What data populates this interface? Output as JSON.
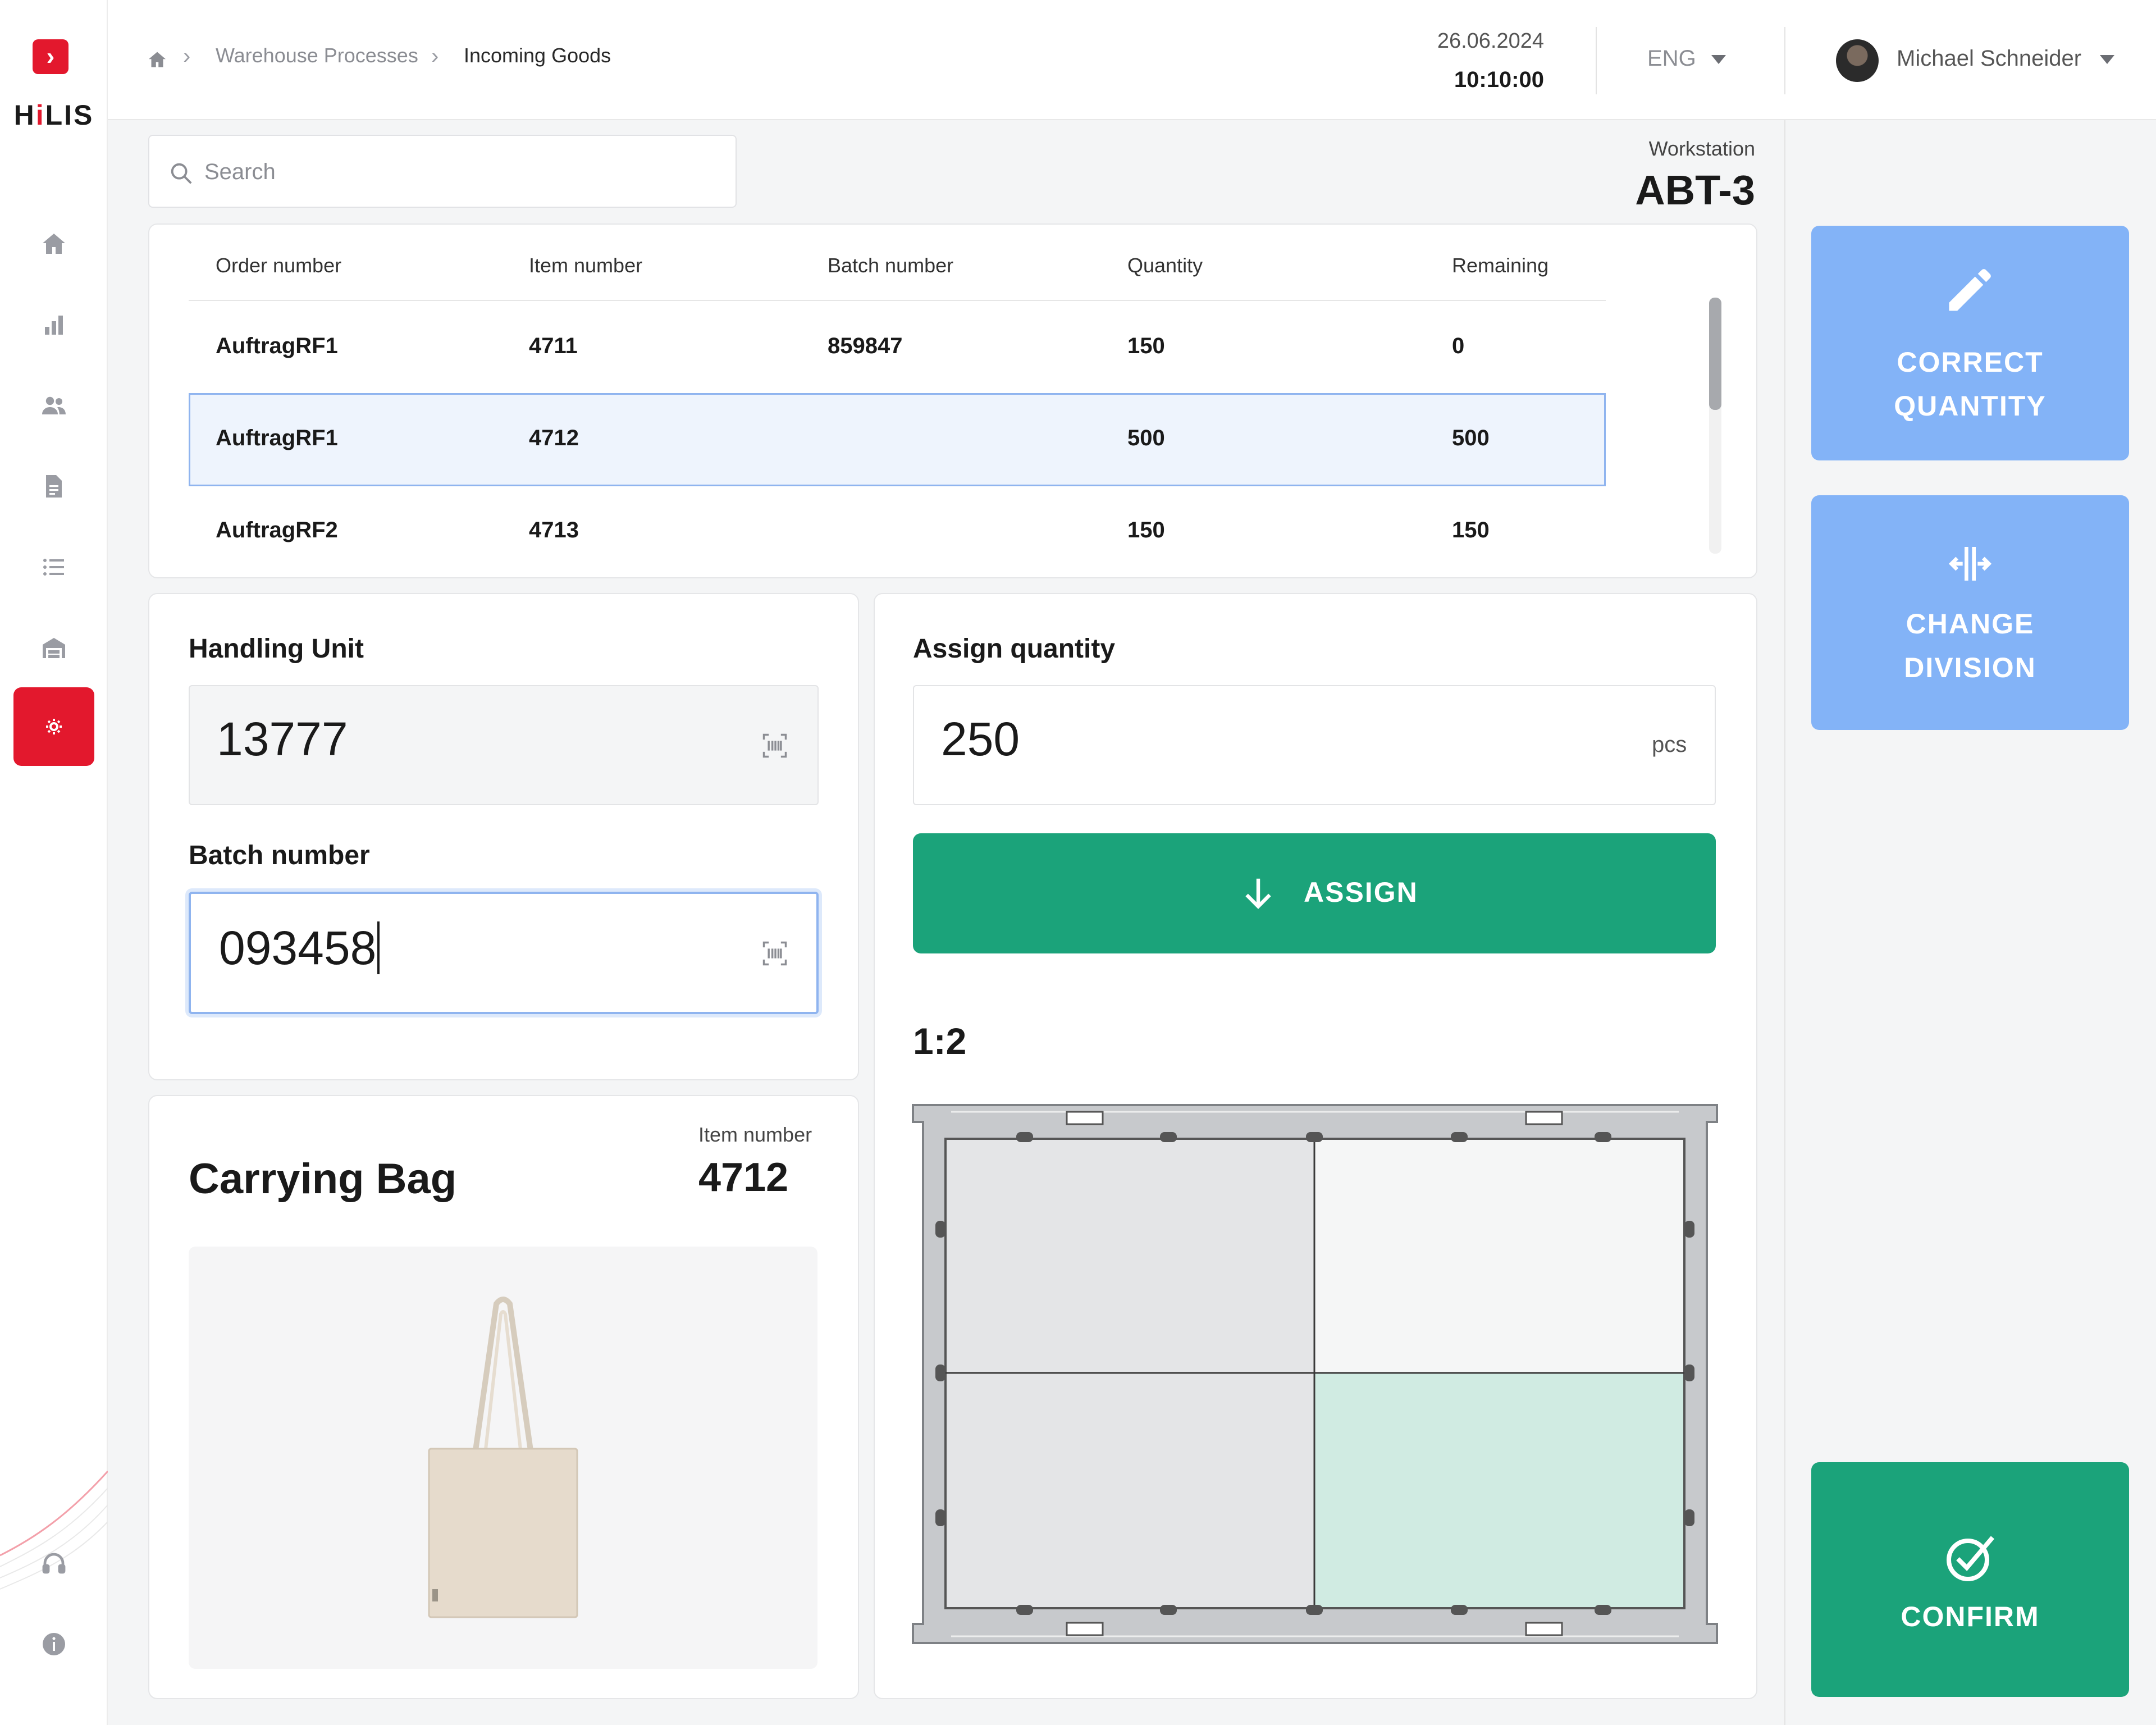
{
  "sidebar": {
    "logo_glyph": "›",
    "brand_h": "H",
    "brand_i": "i",
    "brand_rest": "LIS",
    "items": [
      {
        "icon": "home-icon"
      },
      {
        "icon": "bar-chart-icon"
      },
      {
        "icon": "users-icon"
      },
      {
        "icon": "document-icon"
      },
      {
        "icon": "list-icon"
      },
      {
        "icon": "warehouse-icon"
      },
      {
        "icon": "process-gear-icon",
        "active": true
      }
    ],
    "bottom_items": [
      {
        "icon": "headset-icon"
      },
      {
        "icon": "info-icon"
      }
    ]
  },
  "header": {
    "breadcrumb": [
      "Warehouse Processes",
      "Incoming Goods"
    ],
    "date": "26.06.2024",
    "time": "10:10:00",
    "language": "ENG",
    "user_name": "Michael Schneider"
  },
  "search": {
    "placeholder": "Search"
  },
  "workstation": {
    "label": "Workstation",
    "value": "ABT-3"
  },
  "orders_table": {
    "columns": [
      "Order number",
      "Item number",
      "Batch number",
      "Quantity",
      "Remaining"
    ],
    "rows": [
      [
        "AuftragRF1",
        "4711",
        "859847",
        "150",
        "0"
      ],
      [
        "AuftragRF1",
        "4712",
        "",
        "500",
        "500"
      ],
      [
        "AuftragRF2",
        "4713",
        "",
        "150",
        "150"
      ]
    ],
    "selected_row": 1
  },
  "handling_unit": {
    "label": "Handling Unit",
    "value": "13777"
  },
  "batch": {
    "label": "Batch number",
    "value": "093458"
  },
  "assign": {
    "label": "Assign quantity",
    "value": "250",
    "unit": "pcs",
    "button": "ASSIGN"
  },
  "division": {
    "ratio": "1:2",
    "compartments": 4,
    "highlighted_compartment": 4
  },
  "product": {
    "name": "Carrying Bag",
    "item_label": "Item number",
    "item_value": "4712"
  },
  "actions": {
    "correct_line1": "CORRECT",
    "correct_line2": "QUANTITY",
    "change_line1": "CHANGE",
    "change_line2": "DIVISION",
    "confirm": "CONFIRM"
  },
  "colors": {
    "brand_red": "#e3182d",
    "accent_green": "#1ba37a",
    "action_blue": "#83b3f7",
    "selected_row_border": "#8fb4ef",
    "highlight_compartment": "#d0ebe2"
  }
}
